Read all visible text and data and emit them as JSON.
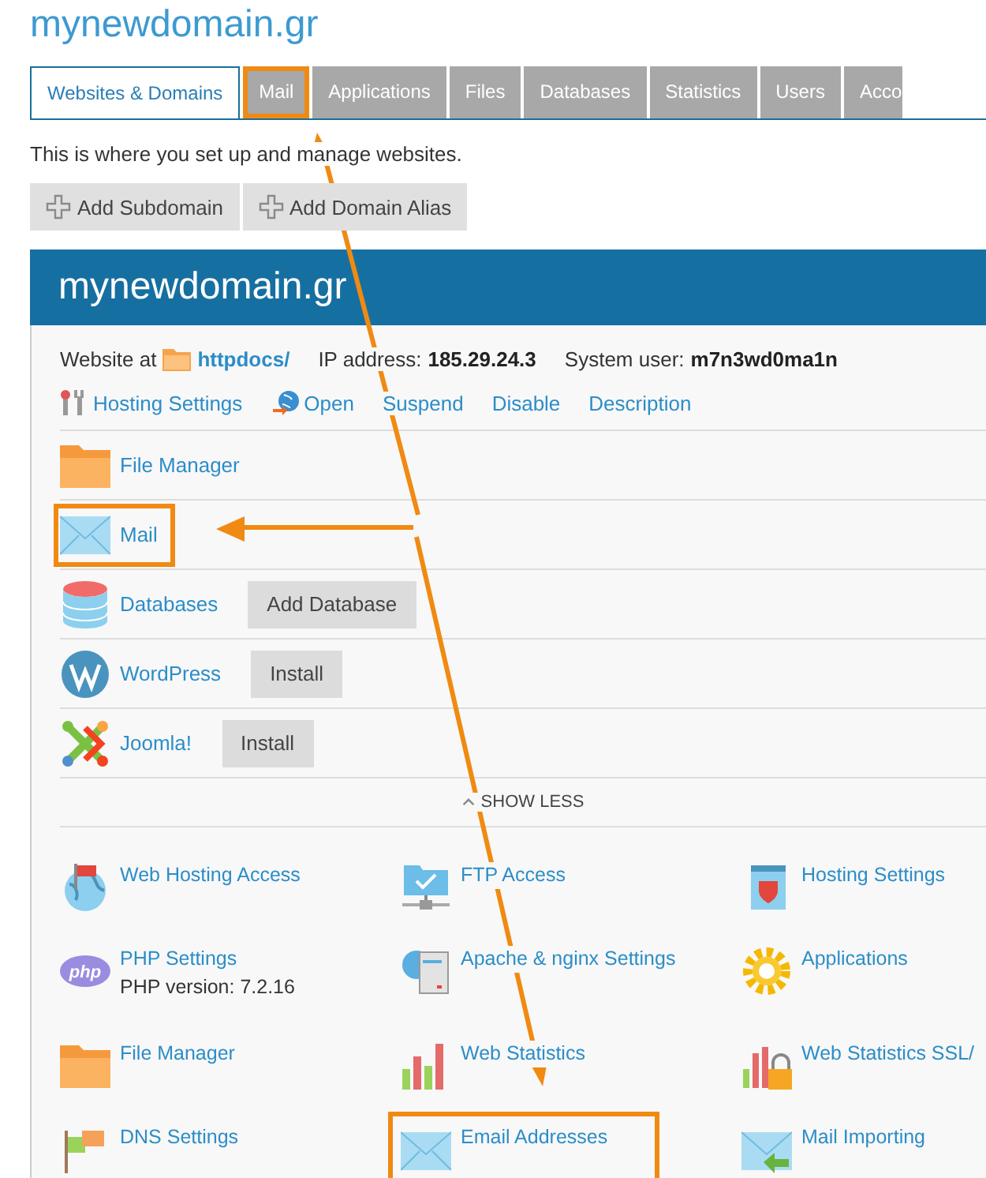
{
  "domain_title": "mynewdomain.gr",
  "tabs": [
    {
      "label": "Websites & Domains",
      "selected": true,
      "highlighted": false
    },
    {
      "label": "Mail",
      "selected": false,
      "highlighted": true
    },
    {
      "label": "Applications",
      "selected": false,
      "highlighted": false
    },
    {
      "label": "Files",
      "selected": false,
      "highlighted": false
    },
    {
      "label": "Databases",
      "selected": false,
      "highlighted": false
    },
    {
      "label": "Statistics",
      "selected": false,
      "highlighted": false
    },
    {
      "label": "Users",
      "selected": false,
      "highlighted": false
    },
    {
      "label": "Acco",
      "selected": false,
      "highlighted": false
    }
  ],
  "description": "This is where you set up and manage websites.",
  "toolbar": [
    "Add Subdomain",
    "Add Domain Alias"
  ],
  "panel": {
    "title": "mynewdomain.gr",
    "info": [
      {
        "label": "Website at",
        "value": "httpdocs/",
        "kind": "folder-link"
      },
      {
        "label": "IP address:",
        "value": "185.29.24.3",
        "kind": "plain"
      },
      {
        "label": "System user:",
        "value": "m7n3wd0ma1n",
        "kind": "plain"
      }
    ],
    "actions": [
      {
        "label": "Hosting Settings",
        "kind": "tools"
      },
      {
        "label": "Open",
        "kind": "globe"
      },
      {
        "label": "Suspend",
        "kind": "text"
      },
      {
        "label": "Disable",
        "kind": "text"
      },
      {
        "label": "Description",
        "kind": "text"
      }
    ],
    "tools": [
      {
        "label": "File Manager",
        "kind": "folder",
        "highlighted": false
      },
      {
        "label": "Mail",
        "kind": "mail",
        "highlighted": true
      },
      {
        "label": "Databases",
        "kind": "database",
        "button": "Add Database",
        "highlighted": false
      },
      {
        "label": "WordPress",
        "kind": "wordpress",
        "button": "Install",
        "highlighted": false
      },
      {
        "label": "Joomla!",
        "kind": "joomla",
        "button": "Install",
        "highlighted": false
      }
    ],
    "show_less": "SHOW LESS",
    "features": [
      {
        "label": "Web Hosting Access",
        "kind": "globe-flag",
        "highlighted": false
      },
      {
        "label": "FTP Access",
        "kind": "ftp",
        "highlighted": false
      },
      {
        "label": "Hosting Settings",
        "kind": "shield",
        "highlighted": false
      },
      {
        "label": "PHP Settings",
        "kind": "php",
        "note": "PHP version: 7.2.16",
        "highlighted": false
      },
      {
        "label": "Apache & nginx Settings",
        "kind": "server",
        "highlighted": false
      },
      {
        "label": "Applications",
        "kind": "gear",
        "highlighted": false
      },
      {
        "label": "File Manager",
        "kind": "folder",
        "highlighted": false
      },
      {
        "label": "Web Statistics",
        "kind": "chart",
        "highlighted": false
      },
      {
        "label": "Web Statistics SSL/",
        "kind": "chart-lock",
        "highlighted": false
      },
      {
        "label": "DNS Settings",
        "kind": "flags",
        "highlighted": false
      },
      {
        "label": "Email Addresses",
        "kind": "mail",
        "highlighted": true
      },
      {
        "label": "Mail Importing",
        "kind": "mail-import",
        "highlighted": false
      }
    ]
  }
}
